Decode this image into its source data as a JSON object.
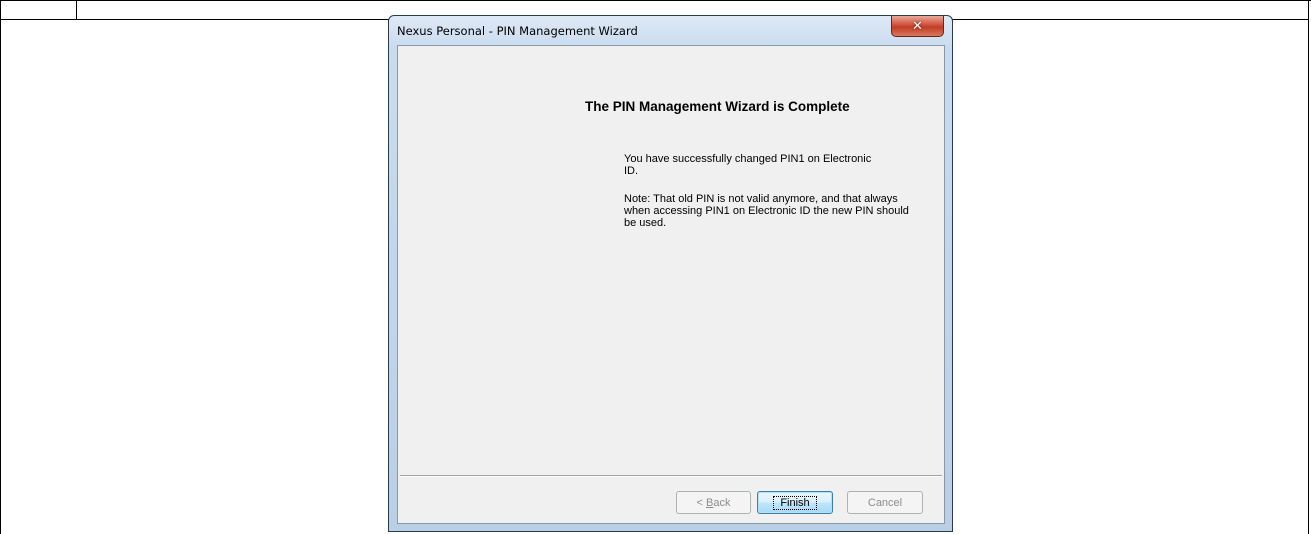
{
  "window": {
    "title": "Nexus Personal - PIN Management Wizard",
    "close_icon": "close-x-icon",
    "close_glyph": "✕"
  },
  "content": {
    "heading": "The PIN Management Wizard is Complete",
    "paragraph1": "You have successfully changed PIN1 on Electronic ID.",
    "paragraph2": "Note: That old PIN is not valid anymore, and that always when accessing PIN1 on Electronic ID the new PIN should be used."
  },
  "buttons": {
    "back_prefix": "< ",
    "back_accel": "B",
    "back_rest": "ack",
    "finish": "Finish",
    "cancel": "Cancel"
  }
}
